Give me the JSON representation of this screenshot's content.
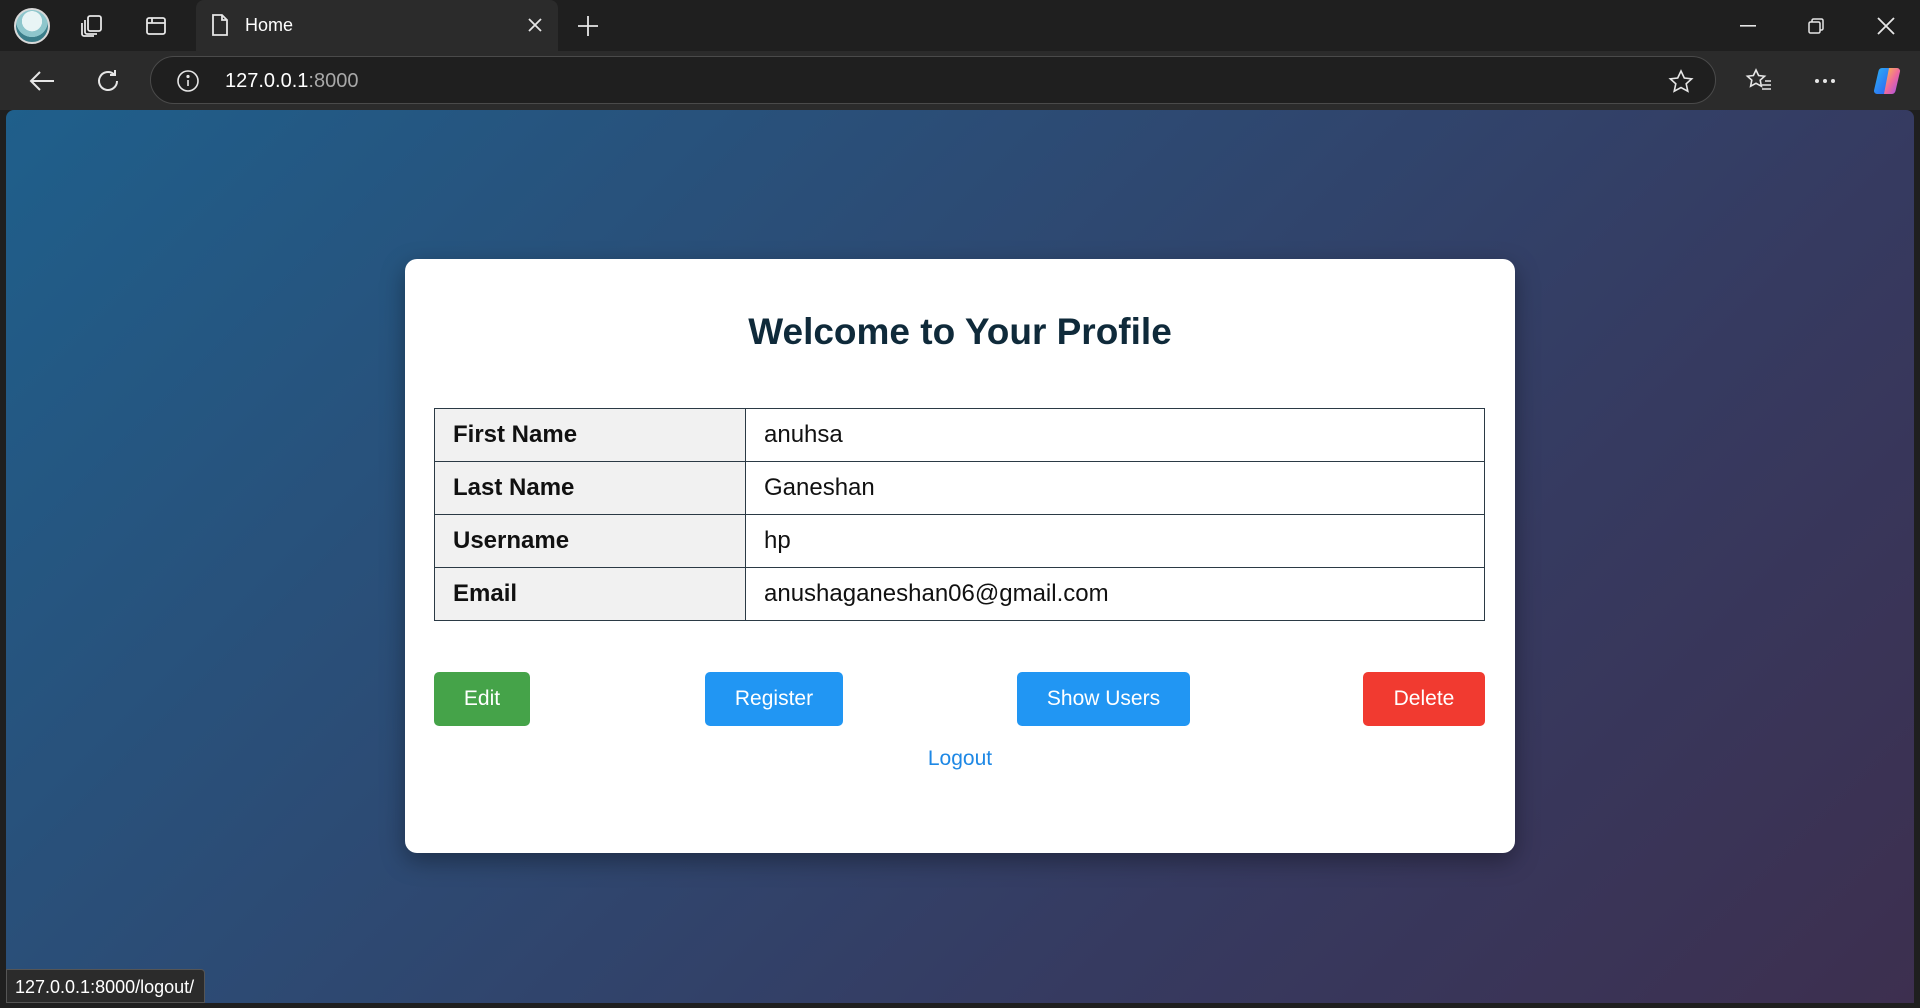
{
  "tab": {
    "title": "Home"
  },
  "address": {
    "host": "127.0.0.1",
    "port": ":8000"
  },
  "page": {
    "title": "Welcome to Your Profile",
    "fields": [
      {
        "label": "First Name",
        "value": "anuhsa"
      },
      {
        "label": "Last Name",
        "value": "Ganeshan"
      },
      {
        "label": "Username",
        "value": "hp"
      },
      {
        "label": "Email",
        "value": "anushaganeshan06@gmail.com"
      }
    ],
    "buttons": {
      "edit": "Edit",
      "register": "Register",
      "show_users": "Show Users",
      "delete": "Delete"
    },
    "logout": "Logout"
  },
  "status_bar": {
    "url": "127.0.0.1:8000/logout/"
  },
  "colors": {
    "edit": "#45a349",
    "register": "#2196f3",
    "show_users": "#2196f3",
    "delete": "#f13a30",
    "link": "#1e88e5"
  }
}
